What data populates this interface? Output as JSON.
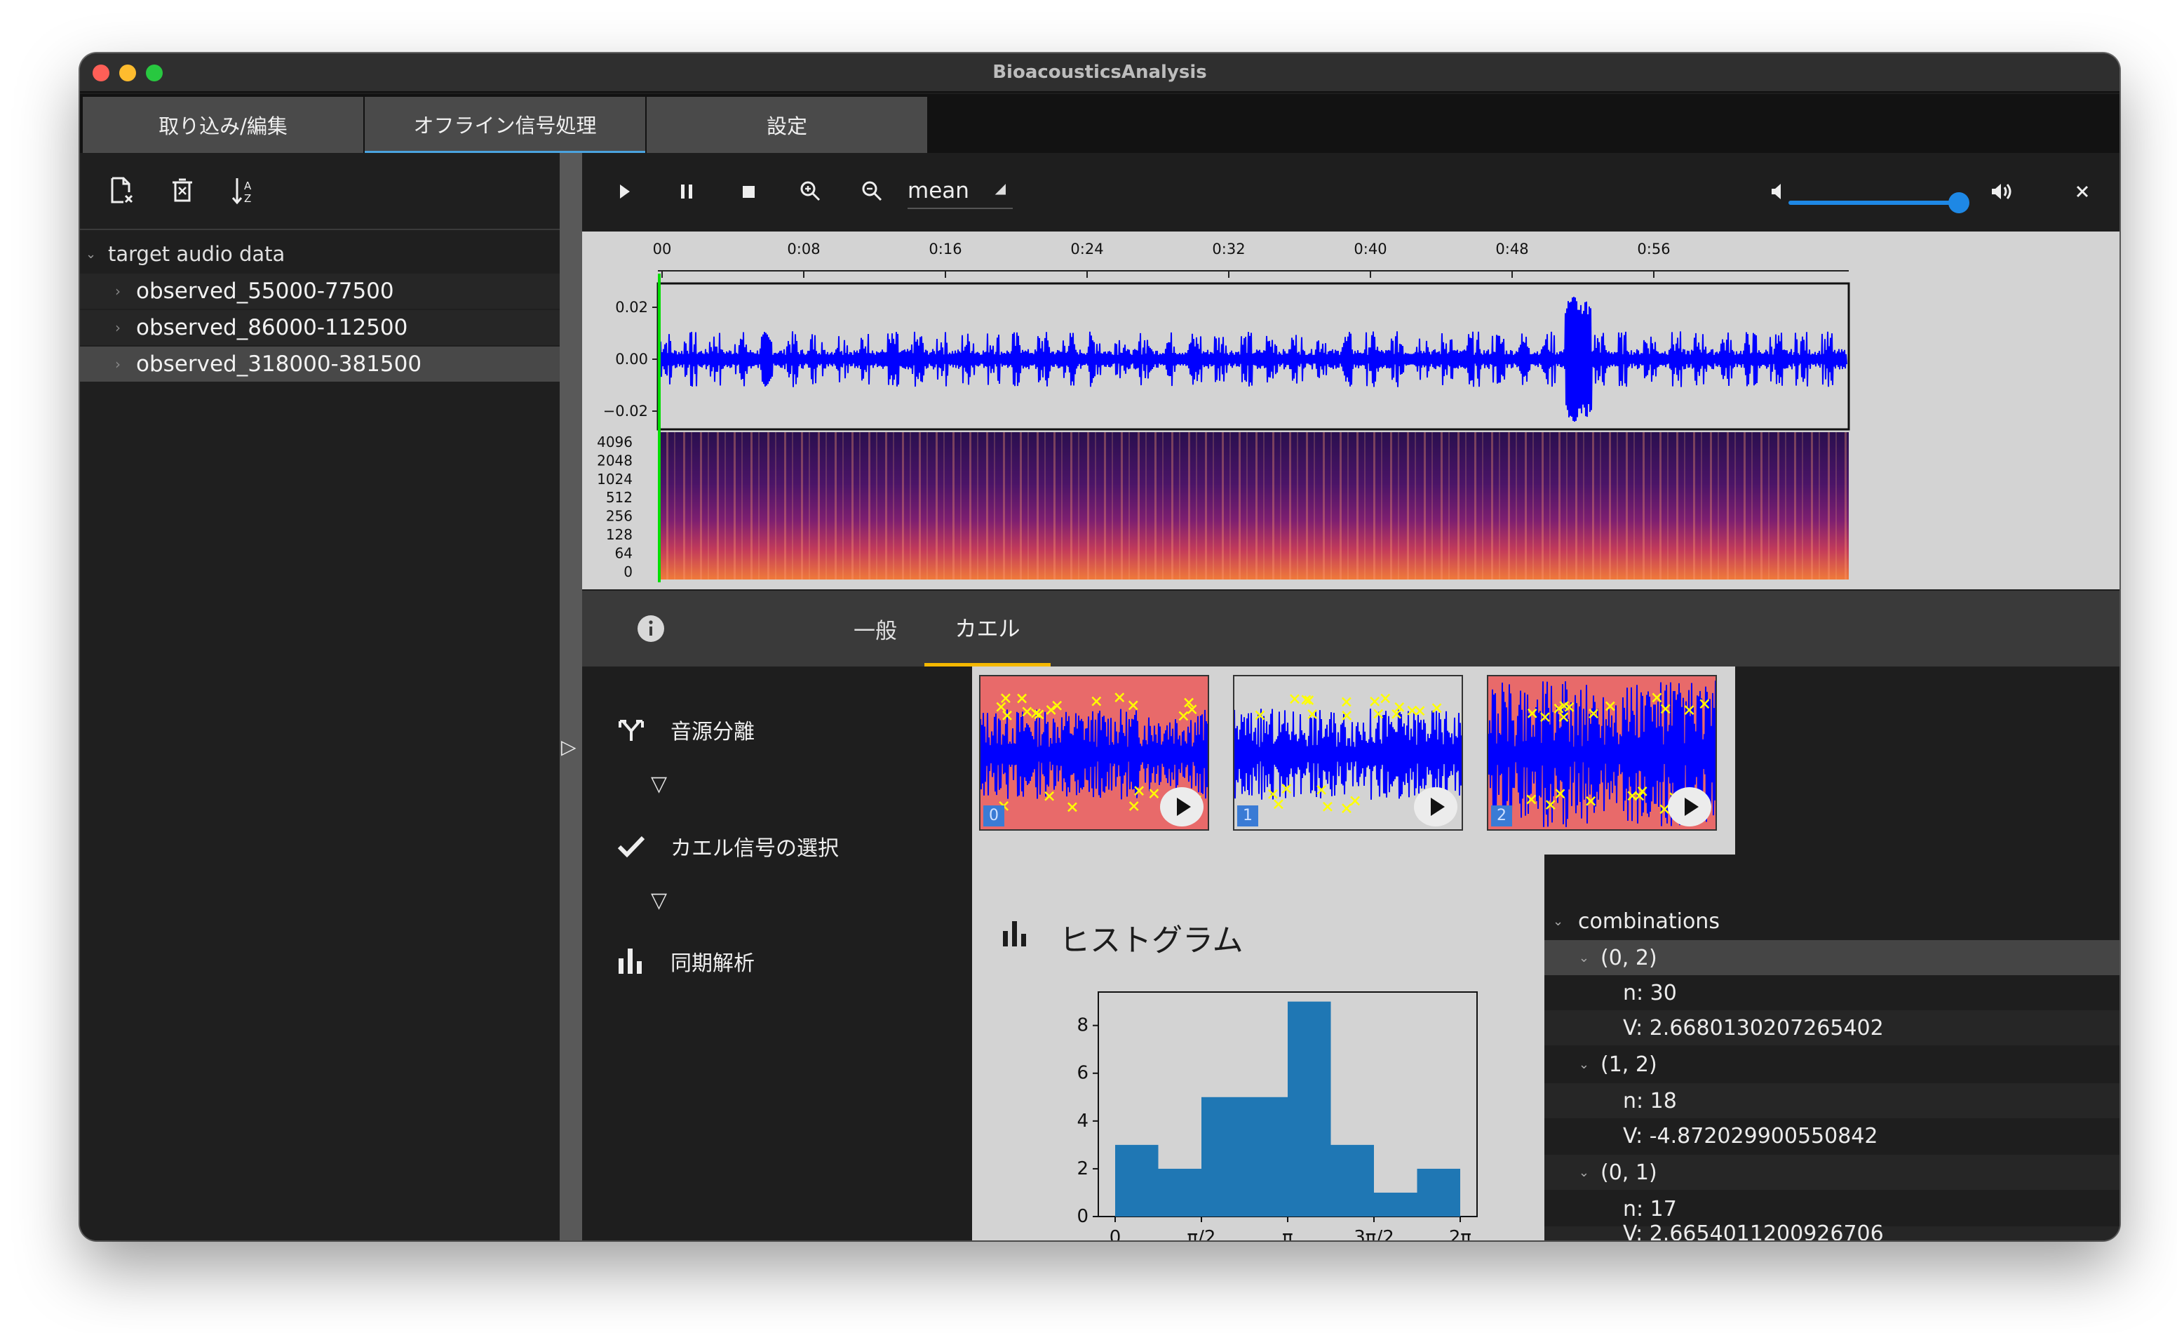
{
  "window": {
    "title": "BioacousticsAnalysis"
  },
  "main_tabs": [
    {
      "label": "取り込み/編集"
    },
    {
      "label": "オフライン信号処理"
    },
    {
      "label": "設定"
    }
  ],
  "active_main_tab": 1,
  "sidebar": {
    "toolbar_icons": [
      "remove-file-icon",
      "delete-icon",
      "sort-icon"
    ],
    "tree": {
      "root_label": "target audio data",
      "items": [
        {
          "label": "observed_55000-77500"
        },
        {
          "label": "observed_86000-112500"
        },
        {
          "label": "observed_318000-381500"
        }
      ],
      "selected_index": 2
    }
  },
  "player": {
    "icons": [
      "play-icon",
      "pause-icon",
      "stop-icon",
      "zoom-in-icon",
      "zoom-out-icon",
      "volume-mute-icon",
      "volume-up-icon",
      "close-icon"
    ],
    "mode": "mean",
    "volume_fraction": 0.95
  },
  "waveform_plot": {
    "time_ticks": [
      "00",
      "0:08",
      "0:16",
      "0:24",
      "0:32",
      "0:40",
      "0:48",
      "0:56"
    ],
    "amp_ticks": [
      "0.02",
      "0.00",
      "−0.02"
    ],
    "freq_ticks": [
      "4096",
      "2048",
      "1024",
      "512",
      "256",
      "128",
      "64",
      "0"
    ],
    "wave_color": "#0000ff",
    "cursor_color": "#00dd00"
  },
  "sub_tabs": [
    {
      "label": ""
    },
    {
      "label": "一般"
    },
    {
      "label": "カエル"
    }
  ],
  "active_sub_tab": 2,
  "steps": [
    {
      "label": "音源分離",
      "icon": "source-separation-icon"
    },
    {
      "label": "カエル信号の選択",
      "icon": "checkmark-icon"
    },
    {
      "label": "同期解析",
      "icon": "bar-chart-icon"
    }
  ],
  "step_arrow": "▽",
  "sources": [
    {
      "index": "0",
      "bg": "#e86a6a"
    },
    {
      "index": "1",
      "bg": "#d3d3d3"
    },
    {
      "index": "2",
      "bg": "#e86a6a"
    }
  ],
  "histogram": {
    "title": "ヒストグラム",
    "bar_color": "#1f77b4"
  },
  "chart_data": {
    "type": "bar",
    "title": "ヒストグラム",
    "categories": [
      "0–π/4",
      "π/4–π/2",
      "π/2–3π/4",
      "3π/4–π",
      "π–5π/4",
      "5π/4–3π/2",
      "3π/2–7π/4",
      "7π/4–2π"
    ],
    "values": [
      3,
      2,
      5,
      5,
      9,
      3,
      1,
      2
    ],
    "x_tick_labels": [
      "0",
      "π/2",
      "π",
      "3π/2",
      "2π"
    ],
    "y_tick_labels": [
      "0",
      "2",
      "4",
      "6",
      "8"
    ],
    "xlim": [
      0,
      6.2832
    ],
    "ylim": [
      0,
      9.4
    ],
    "xlabel": "",
    "ylabel": "",
    "grid": false
  },
  "results": {
    "root_label": "combinations",
    "groups": [
      {
        "label": "(0, 2)",
        "n": "n: 30",
        "v": "V: 2.6680130207265402"
      },
      {
        "label": "(1, 2)",
        "n": "n: 18",
        "v": "V: -4.872029900550842"
      },
      {
        "label": "(0, 1)",
        "n": "n: 17",
        "v": "V: 2.6654011200926706"
      }
    ],
    "selected_index": 0
  }
}
